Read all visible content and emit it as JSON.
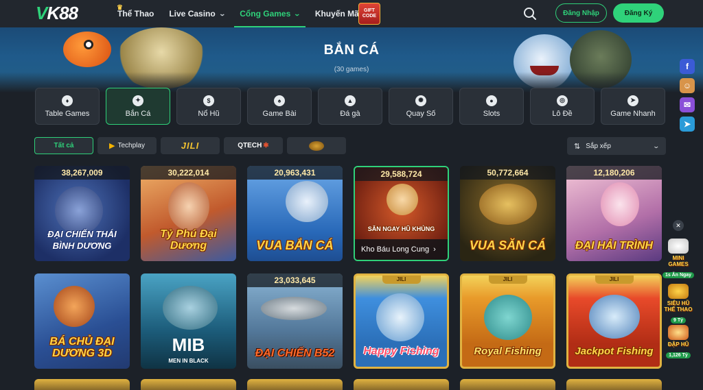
{
  "header": {
    "logo": {
      "v": "V",
      "k": "K",
      "n": "88"
    },
    "nav": [
      {
        "label": "Thể Thao",
        "dropdown": false,
        "active": false
      },
      {
        "label": "Live Casino",
        "dropdown": true,
        "active": false
      },
      {
        "label": "Cổng Games",
        "dropdown": true,
        "active": true
      },
      {
        "label": "Khuyến Mãi",
        "dropdown": true,
        "active": false
      }
    ],
    "gift": {
      "line1": "GIFT",
      "line2": "CODE"
    },
    "login_label": "Đăng Nhập",
    "register_label": "Đăng Ký"
  },
  "banner": {
    "title": "BẮN CÁ",
    "subtitle": "(30 games)"
  },
  "categories": [
    {
      "label": "Table Games",
      "icon": "chip-icon",
      "glyph": "♦",
      "active": false
    },
    {
      "label": "Bắn Cá",
      "icon": "fish-icon",
      "glyph": "✦",
      "active": true
    },
    {
      "label": "Nổ Hũ",
      "icon": "money-bag-icon",
      "glyph": "$",
      "active": false
    },
    {
      "label": "Game Bài",
      "icon": "card-icon",
      "glyph": "♠",
      "active": false
    },
    {
      "label": "Đá gà",
      "icon": "rooster-icon",
      "glyph": "▲",
      "active": false
    },
    {
      "label": "Quay Số",
      "icon": "wheel-icon",
      "glyph": "✺",
      "active": false
    },
    {
      "label": "Slots",
      "icon": "cherry-icon",
      "glyph": "●",
      "active": false
    },
    {
      "label": "Lô Đề",
      "icon": "lottery-icon",
      "glyph": "◎",
      "active": false
    },
    {
      "label": "Game Nhanh",
      "icon": "rocket-icon",
      "glyph": "➤",
      "active": false
    }
  ],
  "providers": [
    {
      "label": "Tất cả",
      "active": true
    },
    {
      "label": "Techplay"
    },
    {
      "label": "JILI"
    },
    {
      "label": "QTECH"
    },
    {
      "label": ""
    }
  ],
  "sort": {
    "label": "Sắp xếp"
  },
  "games": [
    {
      "jackpot": "38,267,009",
      "title": "ĐẠI CHIẾN THÁI BÌNH DƯƠNG",
      "jili": false
    },
    {
      "jackpot": "30,222,014",
      "title": "Tỷ Phú Đại Dương",
      "jili": false
    },
    {
      "jackpot": "20,963,431",
      "title": "VUA BẮN CÁ",
      "jili": false
    },
    {
      "jackpot": "29,588,724",
      "title": "SĂN NGAY HŨ KHỦNG",
      "jili": false,
      "hover": "Kho Báu Long Cung"
    },
    {
      "jackpot": "50,772,664",
      "title": "VUA SĂN CÁ",
      "jili": false
    },
    {
      "jackpot": "12,180,206",
      "title": "ĐẠI HẢI TRÌNH",
      "jili": false
    },
    {
      "jackpot": "",
      "title": "BÁ CHỦ ĐẠI DƯƠNG 3D",
      "jili": false
    },
    {
      "jackpot": "",
      "title": "MIB",
      "subtitle": "MEN IN BLACK",
      "jili": false
    },
    {
      "jackpot": "23,033,645",
      "title": "ĐẠI CHIẾN B52",
      "jili": false
    },
    {
      "jackpot": "",
      "title": "Happy Fishing",
      "jili": true
    },
    {
      "jackpot": "",
      "title": "Royal Fishing",
      "jili": true
    },
    {
      "jackpot": "",
      "title": "Jackpot Fishing",
      "jili": true
    }
  ],
  "jili_tag": "JILI",
  "promos": [
    {
      "line1": "MINI",
      "line2": "GAMES",
      "sub": "1s Ăn Ngay"
    },
    {
      "line1": "SIÊU HŨ",
      "line2": "THẾ THAO",
      "sub": "9 Tỷ"
    },
    {
      "line1": "ĐẬP HŨ",
      "line2": "",
      "sub": "1,126 Tỷ"
    }
  ],
  "social": [
    {
      "icon": "facebook-icon",
      "glyph": "f"
    },
    {
      "icon": "contacts-icon",
      "glyph": "☺"
    },
    {
      "icon": "messenger-icon",
      "glyph": "✉"
    },
    {
      "icon": "telegram-icon",
      "glyph": "➤"
    }
  ],
  "colors": {
    "accent": "#2fd27a",
    "background": "#1c2128",
    "gold": "#ffd64a"
  }
}
